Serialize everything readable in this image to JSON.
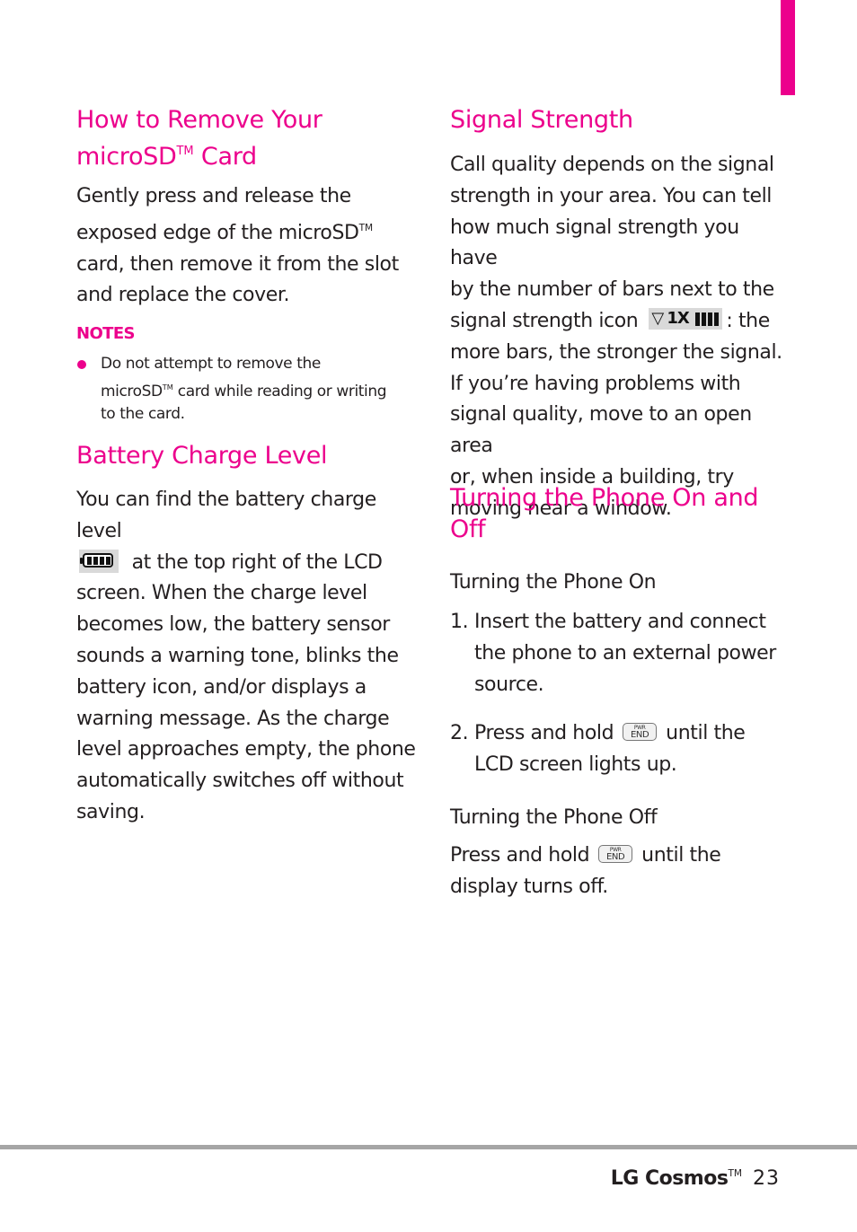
{
  "colors": {
    "accent": "#ec008c",
    "text": "#231f20",
    "rule": "#a6a6a6"
  },
  "left_column": {
    "remove_card": {
      "title_line1": "How to Remove Your",
      "title_line2_prefix": "microSD",
      "title_line2_tm": "TM",
      "title_line2_suffix": " Card",
      "body": [
        {
          "text": "Gently press and release the"
        },
        {
          "text": "exposed edge of the microSD",
          "tm": "TM"
        },
        {
          "text": "card, then remove it from the slot"
        },
        {
          "text": "and replace the cover."
        }
      ]
    },
    "notes": {
      "label": "NOTES",
      "items": [
        {
          "line1": "Do not attempt to remove the",
          "line2_prefix": "microSD",
          "line2_tm": "TM",
          "line2_suffix": " card while reading or writing",
          "line3": "to the card."
        }
      ]
    },
    "battery": {
      "title": "Battery Charge Level",
      "icon": "battery-full-icon",
      "battery_bars": 4,
      "line1": "You can find the battery charge level",
      "line2_after_icon": " at the top right of the LCD",
      "lines": [
        "screen. When the charge level",
        "becomes low, the battery sensor",
        "sounds a warning tone, blinks the",
        "battery icon, and/or displays a",
        "warning message. As the charge",
        "level approaches empty, the phone",
        "automatically switches off without",
        "saving."
      ]
    }
  },
  "right_column": {
    "signal": {
      "title": "Signal Strength",
      "lines_before_icon": [
        "Call quality depends on the signal",
        "strength in your area. You can tell",
        "how much signal strength you have",
        "by the number of bars next to the"
      ],
      "icon_line_prefix": "signal strength icon",
      "icon": "signal-strength-icon",
      "icon_label": "1X",
      "signal_bars": 4,
      "icon_line_suffix": ": the",
      "lines_after_icon": [
        "more bars, the stronger the signal.",
        "If you’re having problems with",
        "signal quality, move to an open area",
        "or, when inside a building, try",
        "moving near a window."
      ]
    },
    "power": {
      "title_line1": "Turning the Phone On and",
      "title_line2": "Off",
      "on": {
        "subtitle": "Turning the Phone On",
        "steps": [
          {
            "num": "1.",
            "lines": [
              "Insert the battery and connect",
              "the phone to an external power",
              "source."
            ]
          },
          {
            "num": "2.",
            "prefix": "Press and hold",
            "suffix": "until the",
            "line2": "LCD screen lights up."
          }
        ]
      },
      "off": {
        "subtitle": "Turning the Phone Off",
        "prefix": "Press and hold",
        "suffix": "until the",
        "line2": "display turns off."
      },
      "key": {
        "icon": "pwr-end-key-icon",
        "top_label": "PWR",
        "main_label": "END"
      }
    }
  },
  "footer": {
    "brand": "LG Cosmos",
    "tm": "TM",
    "page_number": "23"
  }
}
